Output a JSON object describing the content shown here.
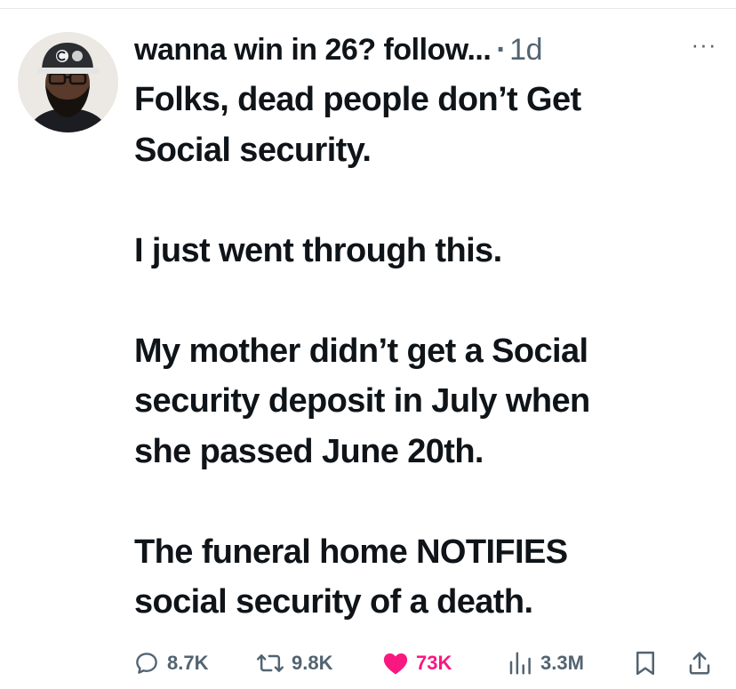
{
  "tweet": {
    "display_name": "wanna win in 26? follow...",
    "separator": "·",
    "timestamp": "1d",
    "more_label": "···",
    "paragraphs": [
      "Folks, dead people don’t Get\nSocial security.",
      "I just went through this.",
      "My mother didn’t get a Social\nsecurity deposit in July when\nshe passed June 20th.",
      "The funeral home NOTIFIES\nsocial security of a death."
    ]
  },
  "actions": {
    "replies": "8.7K",
    "reposts": "9.8K",
    "likes": "73K",
    "views": "3.3M"
  },
  "icons": {
    "reply": "reply-bubble-icon",
    "repost": "repost-icon",
    "like": "heart-filled-icon",
    "views": "views-bar-chart-icon",
    "bookmark": "bookmark-icon",
    "share": "share-icon",
    "more": "more-dots-icon"
  },
  "colors": {
    "text": "#0f1419",
    "muted": "#536471",
    "like": "#f91880"
  }
}
